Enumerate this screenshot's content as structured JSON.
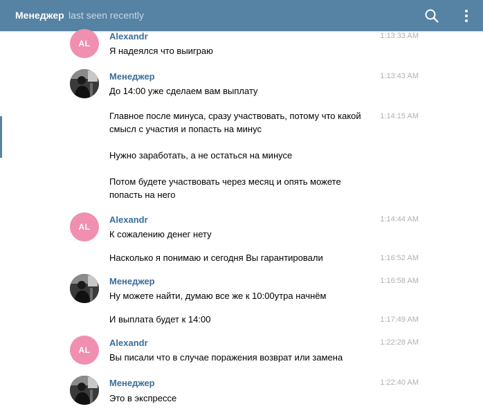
{
  "header": {
    "contact_name": "Менеджер",
    "status": "last seen recently",
    "search_icon": "search-icon",
    "more_icon": "more-vertical-icon"
  },
  "messages": [
    {
      "author": "Alexandr",
      "avatar": "AL",
      "text": "Я надеялся что выиграю",
      "time": "1:13:33 AM"
    },
    {
      "author": "Менеджер",
      "text": "До 14:00 уже сделаем вам выплату",
      "time": "1:13:43 AM"
    },
    {
      "text": "Главное после минуса, сразу участвовать, потому что какой смысл с участия и попасть на минус",
      "time": "1:14:15 AM"
    },
    {
      "text": "Нужно заработать, а не остаться на минусе",
      "time": ""
    },
    {
      "text": "Потом будете участвовать через месяц и опять можете попасть на него",
      "time": ""
    },
    {
      "author": "Alexandr",
      "avatar": "AL",
      "text": "К сожалению денег нету",
      "time": "1:14:44 AM"
    },
    {
      "text": "Насколько я понимаю и сегодня Вы гарантировали",
      "time": "1:16:52 AM"
    },
    {
      "author": "Менеджер",
      "text": "Ну можете найти, думаю все же к 10:00утра начнём",
      "time": "1:16:58 AM"
    },
    {
      "text": "И выплата будет к 14:00",
      "time": "1:17:49 AM"
    },
    {
      "author": "Alexandr",
      "avatar": "AL",
      "text": "Вы писали что в случае поражения возврат или замена",
      "time": "1:22:28 AM"
    },
    {
      "author": "Менеджер",
      "text": "Это в экспрессе",
      "time": "1:22:40 AM"
    }
  ]
}
